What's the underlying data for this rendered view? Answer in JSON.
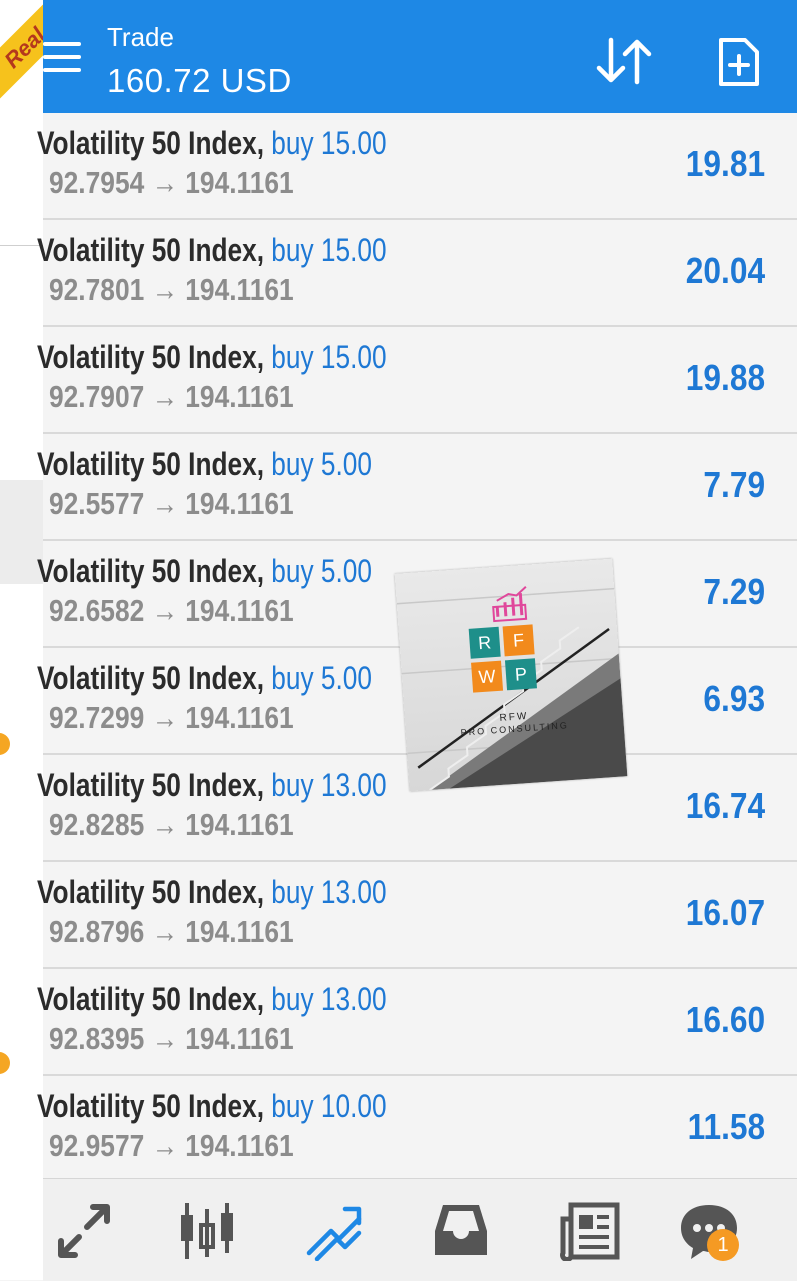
{
  "account_badge": "Real",
  "header": {
    "title": "Trade",
    "balance": "160.72 USD"
  },
  "positions": [
    {
      "symbol": "Volatility 50 Index,",
      "direction": "buy 15.00",
      "open_price": "92.7954",
      "current_price": "194.1161",
      "profit": "19.81"
    },
    {
      "symbol": "Volatility 50 Index,",
      "direction": "buy 15.00",
      "open_price": "92.7801",
      "current_price": "194.1161",
      "profit": "20.04"
    },
    {
      "symbol": "Volatility 50 Index,",
      "direction": "buy 15.00",
      "open_price": "92.7907",
      "current_price": "194.1161",
      "profit": "19.88"
    },
    {
      "symbol": "Volatility 50 Index,",
      "direction": "buy 5.00",
      "open_price": "92.5577",
      "current_price": "194.1161",
      "profit": "7.79"
    },
    {
      "symbol": "Volatility 50 Index,",
      "direction": "buy 5.00",
      "open_price": "92.6582",
      "current_price": "194.1161",
      "profit": "7.29"
    },
    {
      "symbol": "Volatility 50 Index,",
      "direction": "buy 5.00",
      "open_price": "92.7299",
      "current_price": "194.1161",
      "profit": "6.93"
    },
    {
      "symbol": "Volatility 50 Index,",
      "direction": "buy 13.00",
      "open_price": "92.8285",
      "current_price": "194.1161",
      "profit": "16.74"
    },
    {
      "symbol": "Volatility 50 Index,",
      "direction": "buy 13.00",
      "open_price": "92.8796",
      "current_price": "194.1161",
      "profit": "16.07"
    },
    {
      "symbol": "Volatility 50 Index,",
      "direction": "buy 13.00",
      "open_price": "92.8395",
      "current_price": "194.1161",
      "profit": "16.60"
    },
    {
      "symbol": "Volatility 50 Index,",
      "direction": "buy 10.00",
      "open_price": "92.9577",
      "current_price": "194.1161",
      "profit": "11.58"
    }
  ],
  "arrow": "→",
  "watermark": {
    "tiles": [
      "R",
      "F",
      "W",
      "P"
    ],
    "line1": "RFW",
    "line2": "PRO CONSULTING"
  },
  "bottom_nav": {
    "items": [
      "quotes-icon",
      "chart-icon",
      "trade-icon",
      "inbox-icon",
      "news-icon",
      "chat-icon"
    ],
    "active": "trade-icon",
    "chat_badge": "1"
  },
  "colors": {
    "header": "#1e88e5",
    "accent_blue": "#1e78d4",
    "badge_orange": "#f59a23"
  }
}
